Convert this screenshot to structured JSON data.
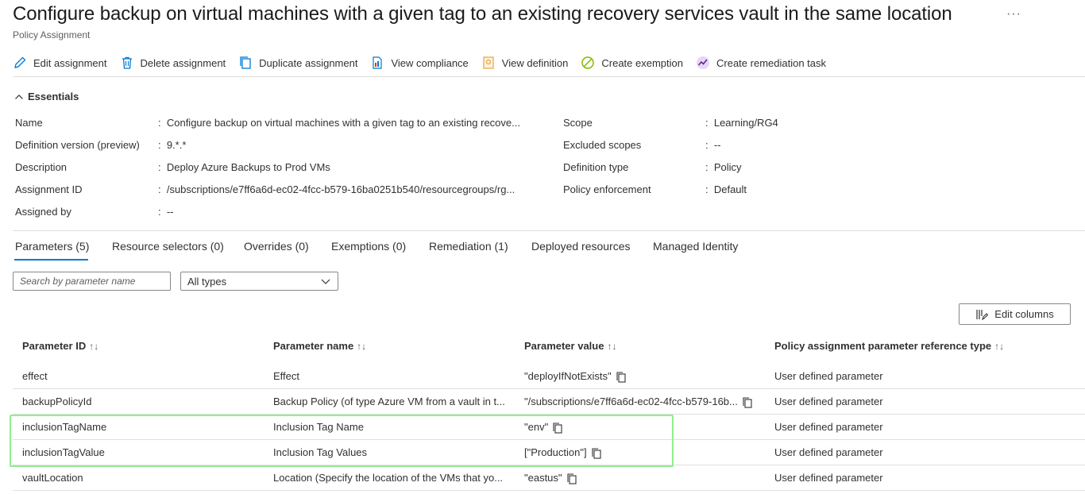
{
  "header": {
    "title": "Configure backup on virtual machines with a given tag to an existing recovery services vault in the same location",
    "subtitle": "Policy Assignment",
    "more_label": "···"
  },
  "toolbar": {
    "items": [
      {
        "label": "Edit assignment",
        "icon": "pencil-icon"
      },
      {
        "label": "Delete assignment",
        "icon": "trash-icon"
      },
      {
        "label": "Duplicate assignment",
        "icon": "duplicate-icon"
      },
      {
        "label": "View compliance",
        "icon": "compliance-icon"
      },
      {
        "label": "View definition",
        "icon": "definition-icon"
      },
      {
        "label": "Create exemption",
        "icon": "exemption-icon"
      },
      {
        "label": "Create remediation task",
        "icon": "remediation-icon"
      }
    ]
  },
  "essentials": {
    "heading": "Essentials",
    "left": [
      {
        "label": "Name",
        "value": "Configure backup on virtual machines with a given tag to an existing recove..."
      },
      {
        "label": "Definition version (preview)",
        "value": "9.*.*"
      },
      {
        "label": "Description",
        "value": "Deploy Azure Backups to Prod VMs"
      },
      {
        "label": "Assignment ID",
        "value": "/subscriptions/e7ff6a6d-ec02-4fcc-b579-16ba0251b540/resourcegroups/rg..."
      },
      {
        "label": "Assigned by",
        "value": "--"
      }
    ],
    "right": [
      {
        "label": "Scope",
        "value": "Learning/RG4"
      },
      {
        "label": "Excluded scopes",
        "value": "--"
      },
      {
        "label": "Definition type",
        "value": "Policy"
      },
      {
        "label": "Policy enforcement",
        "value": "Default"
      }
    ]
  },
  "tabs": [
    {
      "label": "Parameters (5)",
      "active": true
    },
    {
      "label": "Resource selectors (0)"
    },
    {
      "label": "Overrides (0)"
    },
    {
      "label": "Exemptions (0)"
    },
    {
      "label": "Remediation (1)"
    },
    {
      "label": "Deployed resources"
    },
    {
      "label": "Managed Identity"
    }
  ],
  "filters": {
    "search_placeholder": "Search by parameter name",
    "type_selected": "All types"
  },
  "edit_columns_label": "Edit columns",
  "table": {
    "columns": [
      "Parameter ID",
      "Parameter name",
      "Parameter value",
      "Policy assignment parameter reference type"
    ],
    "rows": [
      {
        "id": "effect",
        "name": "Effect",
        "value": "\"deployIfNotExists\"",
        "ref": "User defined parameter"
      },
      {
        "id": "backupPolicyId",
        "name": "Backup Policy (of type Azure VM from a vault in t...",
        "value": "\"/subscriptions/e7ff6a6d-ec02-4fcc-b579-16b...",
        "ref": "User defined parameter"
      },
      {
        "id": "inclusionTagName",
        "name": "Inclusion Tag Name",
        "value": "\"env\"",
        "ref": "User defined parameter"
      },
      {
        "id": "inclusionTagValue",
        "name": "Inclusion Tag Values",
        "value": "[\"Production\"]",
        "ref": "User defined parameter"
      },
      {
        "id": "vaultLocation",
        "name": "Location (Specify the location of the VMs that yo...",
        "value": "\"eastus\"",
        "ref": "User defined parameter"
      }
    ]
  },
  "colors": {
    "accent": "#0078d4",
    "highlight": "#90ee90"
  }
}
